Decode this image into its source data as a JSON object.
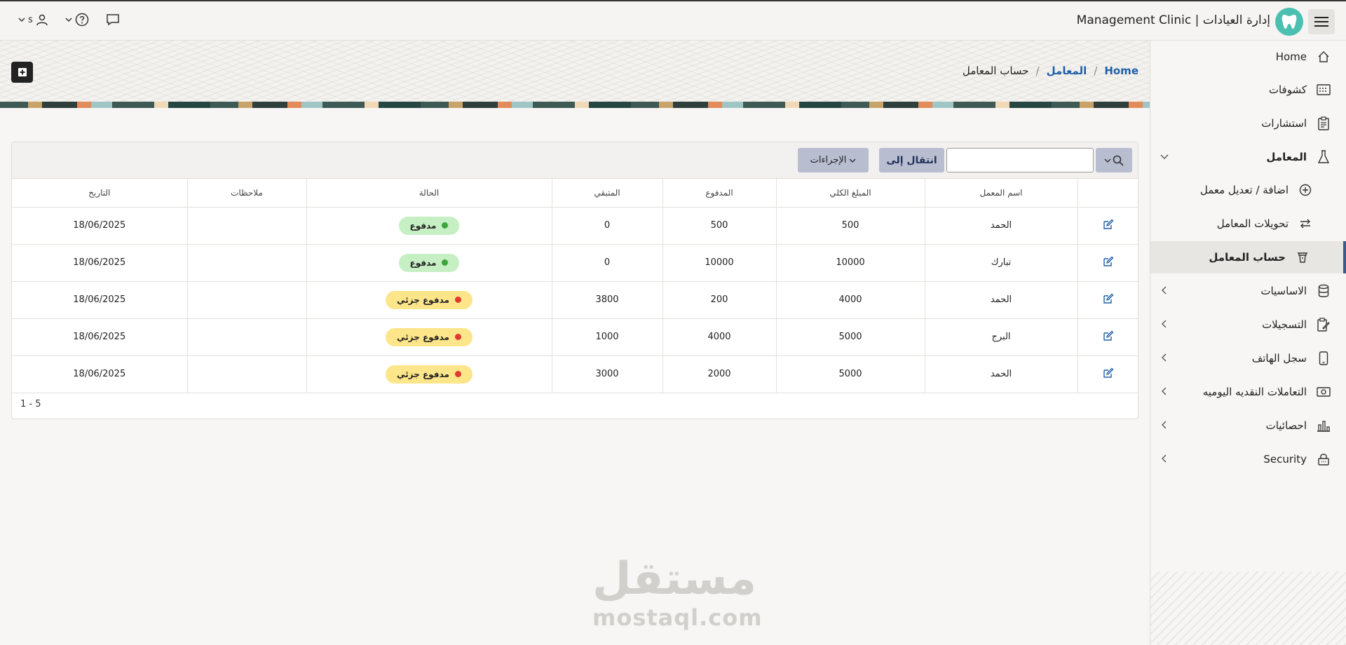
{
  "app": {
    "title": "Management Clinic | إدارة العيادات",
    "user": "s"
  },
  "sidebar": {
    "items": [
      {
        "label": "Home",
        "icon": "home-icon"
      },
      {
        "label": "كشوفات",
        "icon": "calendar-icon"
      },
      {
        "label": "استشارات",
        "icon": "clipboard-icon"
      },
      {
        "label": "المعامل",
        "icon": "flask-icon"
      },
      {
        "label": "اضافة / تعديل معمل",
        "icon": "plus-circle-icon"
      },
      {
        "label": "تحويلات المعامل",
        "icon": "transfer-icon"
      },
      {
        "label": "حساب المعامل",
        "icon": "account-icon"
      },
      {
        "label": "الاساسيات",
        "icon": "database-icon"
      },
      {
        "label": "التسجيلات",
        "icon": "edit-clipboard-icon"
      },
      {
        "label": "سجل الهاتف",
        "icon": "phone-icon"
      },
      {
        "label": "التعاملات النقديه اليوميه",
        "icon": "cash-icon"
      },
      {
        "label": "احصائيات",
        "icon": "chart-icon"
      },
      {
        "label": "Security",
        "icon": "lock-icon"
      }
    ]
  },
  "breadcrumb": {
    "home": "Home",
    "labs": "المعامل",
    "separator": "/",
    "current": "حساب المعامل"
  },
  "toolbar": {
    "search_value": "",
    "go_label": "انتقال إلى",
    "actions_label": "الإجراءات"
  },
  "table": {
    "headers": {
      "lab_name": "اسم المعمل",
      "total": "المبلغ الكلي",
      "paid": "المدفوع",
      "remaining": "المتبقي",
      "status": "الحالة",
      "notes": "ملاحظات",
      "date": "التاريخ"
    },
    "rows": [
      {
        "lab_name": "الحمد",
        "total": "500",
        "paid": "500",
        "remaining": "0",
        "status": "مدفوع",
        "notes": "",
        "date": "18/06/2025"
      },
      {
        "lab_name": "تبارك",
        "total": "10000",
        "paid": "10000",
        "remaining": "0",
        "status": "مدفوع",
        "notes": "",
        "date": "18/06/2025"
      },
      {
        "lab_name": "الحمد",
        "total": "4000",
        "paid": "200",
        "remaining": "3800",
        "status": "مدفوع جزئي",
        "notes": "",
        "date": "18/06/2025"
      },
      {
        "lab_name": "البرج",
        "total": "5000",
        "paid": "4000",
        "remaining": "1000",
        "status": "مدفوع جزئي",
        "notes": "",
        "date": "18/06/2025"
      },
      {
        "lab_name": "الحمد",
        "total": "5000",
        "paid": "2000",
        "remaining": "3000",
        "status": "مدفوع جزئي",
        "notes": "",
        "date": "18/06/2025"
      }
    ],
    "pagination": "1 - 5"
  },
  "colors": {
    "paid_bg": "#c6efc4",
    "paid_dot": "#3aa63a",
    "partial_bg": "#fde58a",
    "partial_dot": "#e03a2f",
    "accent": "#1f5fa8"
  },
  "watermark": {
    "arabic": "مستقل",
    "latin": "mostaql.com"
  }
}
